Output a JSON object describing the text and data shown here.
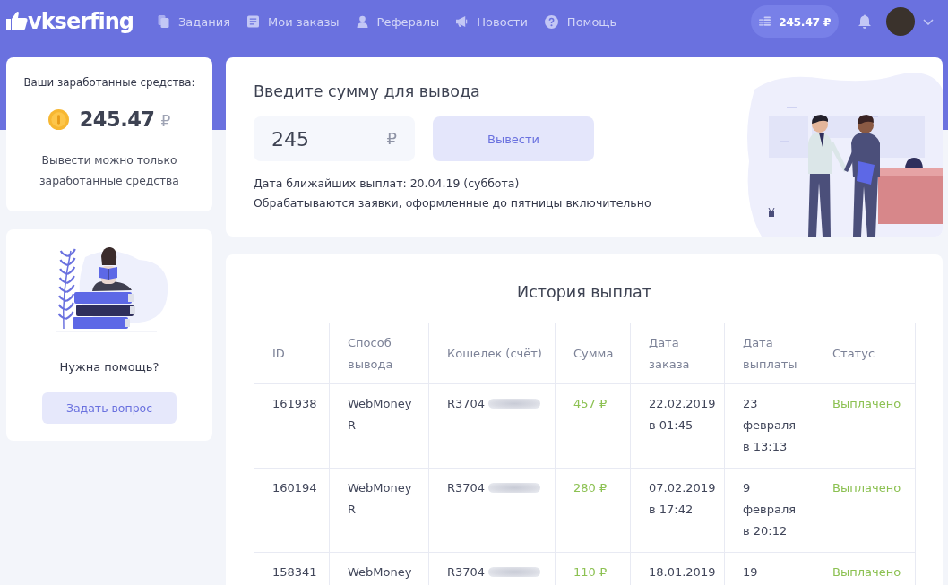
{
  "header": {
    "logo": "vkserfing",
    "nav": [
      {
        "label": "Задания"
      },
      {
        "label": "Мои заказы"
      },
      {
        "label": "Рефералы"
      },
      {
        "label": "Новости"
      },
      {
        "label": "Помощь"
      }
    ],
    "balance": "245.47 ₽"
  },
  "balance_card": {
    "title": "Ваши заработанные средства:",
    "amount": "245.47",
    "currency": "₽",
    "note": "Вывести можно только заработанные средства"
  },
  "help_card": {
    "title": "Нужна помощь?",
    "button": "Задать вопрос"
  },
  "withdraw": {
    "title": "Введите сумму для вывода",
    "value": "245",
    "currency": "₽",
    "button": "Вывести",
    "info": [
      "Дата ближайших выплат: 20.04.19 (суббота)",
      "Обрабатываются заявки, оформленные до пятницы включительно"
    ]
  },
  "history": {
    "title": "История выплат",
    "columns": [
      "ID",
      "Способ вывода",
      "Кошелек (счёт)",
      "Сумма",
      "Дата заказа",
      "Дата выплаты",
      "Статус"
    ],
    "rows": [
      {
        "id": "161938",
        "method": "WebMoney R",
        "wallet": "R3704",
        "masked": true,
        "amount": "457 ₽",
        "order_date": "22.02.2019 в 01:45",
        "payout_date": "23 февраля в 13:13",
        "status": "Выплачено"
      },
      {
        "id": "160194",
        "method": "WebMoney R",
        "wallet": "R3704",
        "masked": true,
        "amount": "280 ₽",
        "order_date": "07.02.2019 в 17:42",
        "payout_date": "9 февраля в 20:12",
        "status": "Выплачено"
      },
      {
        "id": "158341",
        "method": "WebMoney",
        "wallet": "R3704",
        "masked": true,
        "amount": "110 ₽",
        "order_date": "18.01.2019",
        "payout_date": "19",
        "status": "Выплачено"
      }
    ]
  }
}
